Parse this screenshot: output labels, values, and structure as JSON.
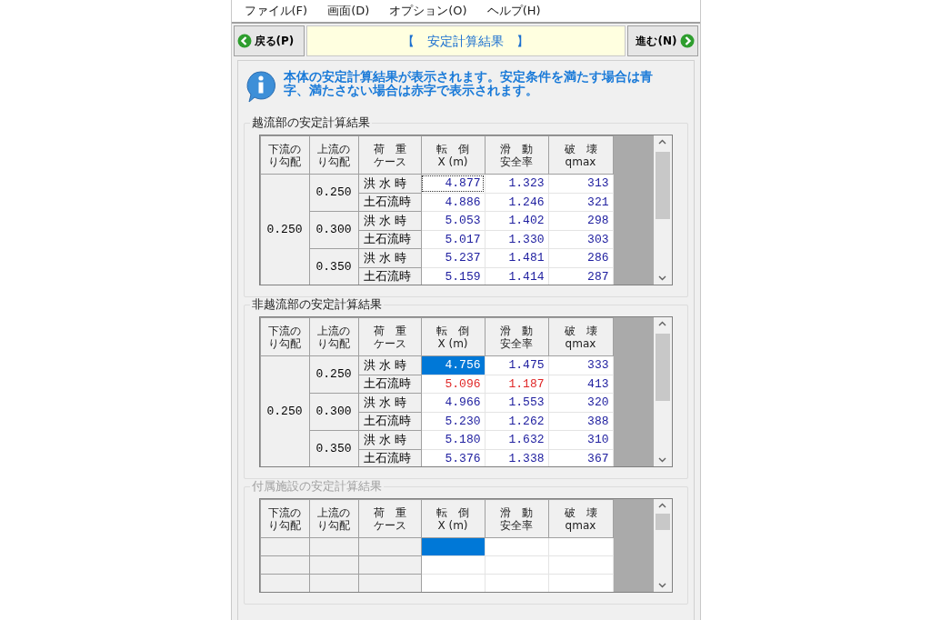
{
  "menu": [
    "ファイル(F)",
    "画面(D)",
    "オプション(O)",
    "ヘルプ(H)"
  ],
  "nav": {
    "back": "戻る(P)",
    "title": "【　安定計算結果　】",
    "forward": "進む(N)"
  },
  "info": "本体の安定計算結果が表示されます。安定条件を満たす場合は青字、満たさない場合は赤字で表示されます。",
  "sections": [
    {
      "title": "越流部の安定計算結果",
      "disabled": false,
      "columns": [
        [
          "下流の",
          "り勾配"
        ],
        [
          "上流の",
          "り勾配"
        ],
        [
          "荷　重",
          "ケース"
        ],
        [
          "転　倒",
          "X (m)"
        ],
        [
          "滑　動",
          "安全率"
        ],
        [
          "破　壊",
          "qmax"
        ]
      ],
      "groups": [
        {
          "downstream": "0.250",
          "upstreams": [
            {
              "value": "0.250",
              "rows": [
                {
                  "case": "洪 水 時",
                  "cells": [
                    {
                      "text": "4.877",
                      "fail": false,
                      "selected": false,
                      "focused": true
                    },
                    {
                      "text": "1.323",
                      "fail": false,
                      "selected": false,
                      "focused": false
                    },
                    {
                      "text": "313",
                      "fail": false,
                      "selected": false,
                      "focused": false
                    }
                  ]
                },
                {
                  "case": "土石流時",
                  "cells": [
                    {
                      "text": "4.886",
                      "fail": false,
                      "selected": false,
                      "focused": false
                    },
                    {
                      "text": "1.246",
                      "fail": false,
                      "selected": false,
                      "focused": false
                    },
                    {
                      "text": "321",
                      "fail": false,
                      "selected": false,
                      "focused": false
                    }
                  ]
                }
              ]
            },
            {
              "value": "0.300",
              "rows": [
                {
                  "case": "洪 水 時",
                  "cells": [
                    {
                      "text": "5.053",
                      "fail": false,
                      "selected": false,
                      "focused": false
                    },
                    {
                      "text": "1.402",
                      "fail": false,
                      "selected": false,
                      "focused": false
                    },
                    {
                      "text": "298",
                      "fail": false,
                      "selected": false,
                      "focused": false
                    }
                  ]
                },
                {
                  "case": "土石流時",
                  "cells": [
                    {
                      "text": "5.017",
                      "fail": false,
                      "selected": false,
                      "focused": false
                    },
                    {
                      "text": "1.330",
                      "fail": false,
                      "selected": false,
                      "focused": false
                    },
                    {
                      "text": "303",
                      "fail": false,
                      "selected": false,
                      "focused": false
                    }
                  ]
                }
              ]
            },
            {
              "value": "0.350",
              "rows": [
                {
                  "case": "洪 水 時",
                  "cells": [
                    {
                      "text": "5.237",
                      "fail": false,
                      "selected": false,
                      "focused": false
                    },
                    {
                      "text": "1.481",
                      "fail": false,
                      "selected": false,
                      "focused": false
                    },
                    {
                      "text": "286",
                      "fail": false,
                      "selected": false,
                      "focused": false
                    }
                  ]
                },
                {
                  "case": "土石流時",
                  "cells": [
                    {
                      "text": "5.159",
                      "fail": false,
                      "selected": false,
                      "focused": false
                    },
                    {
                      "text": "1.414",
                      "fail": false,
                      "selected": false,
                      "focused": false
                    },
                    {
                      "text": "287",
                      "fail": false,
                      "selected": false,
                      "focused": false
                    }
                  ]
                }
              ]
            }
          ]
        }
      ]
    },
    {
      "title": "非越流部の安定計算結果",
      "disabled": false,
      "columns": [
        [
          "下流の",
          "り勾配"
        ],
        [
          "上流の",
          "り勾配"
        ],
        [
          "荷　重",
          "ケース"
        ],
        [
          "転　倒",
          "X (m)"
        ],
        [
          "滑　動",
          "安全率"
        ],
        [
          "破　壊",
          "qmax"
        ]
      ],
      "groups": [
        {
          "downstream": "0.250",
          "upstreams": [
            {
              "value": "0.250",
              "rows": [
                {
                  "case": "洪 水 時",
                  "cells": [
                    {
                      "text": "4.756",
                      "fail": false,
                      "selected": true,
                      "focused": false
                    },
                    {
                      "text": "1.475",
                      "fail": false,
                      "selected": false,
                      "focused": false
                    },
                    {
                      "text": "333",
                      "fail": false,
                      "selected": false,
                      "focused": false
                    }
                  ]
                },
                {
                  "case": "土石流時",
                  "cells": [
                    {
                      "text": "5.096",
                      "fail": true,
                      "selected": false,
                      "focused": false
                    },
                    {
                      "text": "1.187",
                      "fail": true,
                      "selected": false,
                      "focused": false
                    },
                    {
                      "text": "413",
                      "fail": false,
                      "selected": false,
                      "focused": false
                    }
                  ]
                }
              ]
            },
            {
              "value": "0.300",
              "rows": [
                {
                  "case": "洪 水 時",
                  "cells": [
                    {
                      "text": "4.966",
                      "fail": false,
                      "selected": false,
                      "focused": false
                    },
                    {
                      "text": "1.553",
                      "fail": false,
                      "selected": false,
                      "focused": false
                    },
                    {
                      "text": "320",
                      "fail": false,
                      "selected": false,
                      "focused": false
                    }
                  ]
                },
                {
                  "case": "土石流時",
                  "cells": [
                    {
                      "text": "5.230",
                      "fail": false,
                      "selected": false,
                      "focused": false
                    },
                    {
                      "text": "1.262",
                      "fail": false,
                      "selected": false,
                      "focused": false
                    },
                    {
                      "text": "388",
                      "fail": false,
                      "selected": false,
                      "focused": false
                    }
                  ]
                }
              ]
            },
            {
              "value": "0.350",
              "rows": [
                {
                  "case": "洪 水 時",
                  "cells": [
                    {
                      "text": "5.180",
                      "fail": false,
                      "selected": false,
                      "focused": false
                    },
                    {
                      "text": "1.632",
                      "fail": false,
                      "selected": false,
                      "focused": false
                    },
                    {
                      "text": "310",
                      "fail": false,
                      "selected": false,
                      "focused": false
                    }
                  ]
                },
                {
                  "case": "土石流時",
                  "cells": [
                    {
                      "text": "5.376",
                      "fail": false,
                      "selected": false,
                      "focused": false
                    },
                    {
                      "text": "1.338",
                      "fail": false,
                      "selected": false,
                      "focused": false
                    },
                    {
                      "text": "367",
                      "fail": false,
                      "selected": false,
                      "focused": false
                    }
                  ]
                }
              ]
            }
          ]
        }
      ]
    },
    {
      "title": "付属施設の安定計算結果",
      "disabled": true,
      "columns": [
        [
          "下流の",
          "り勾配"
        ],
        [
          "上流の",
          "り勾配"
        ],
        [
          "荷　重",
          "ケース"
        ],
        [
          "転　倒",
          "X (m)"
        ],
        [
          "滑　動",
          "安全率"
        ],
        [
          "破　壊",
          "qmax"
        ]
      ],
      "empty_rows": [
        {
          "cells": [
            {
              "selected": true
            },
            {
              "selected": false
            },
            {
              "selected": false
            }
          ]
        },
        {
          "cells": [
            {
              "selected": false
            },
            {
              "selected": false
            },
            {
              "selected": false
            }
          ]
        },
        {
          "cells": [
            {
              "selected": false
            },
            {
              "selected": false
            },
            {
              "selected": false
            }
          ]
        }
      ]
    }
  ]
}
